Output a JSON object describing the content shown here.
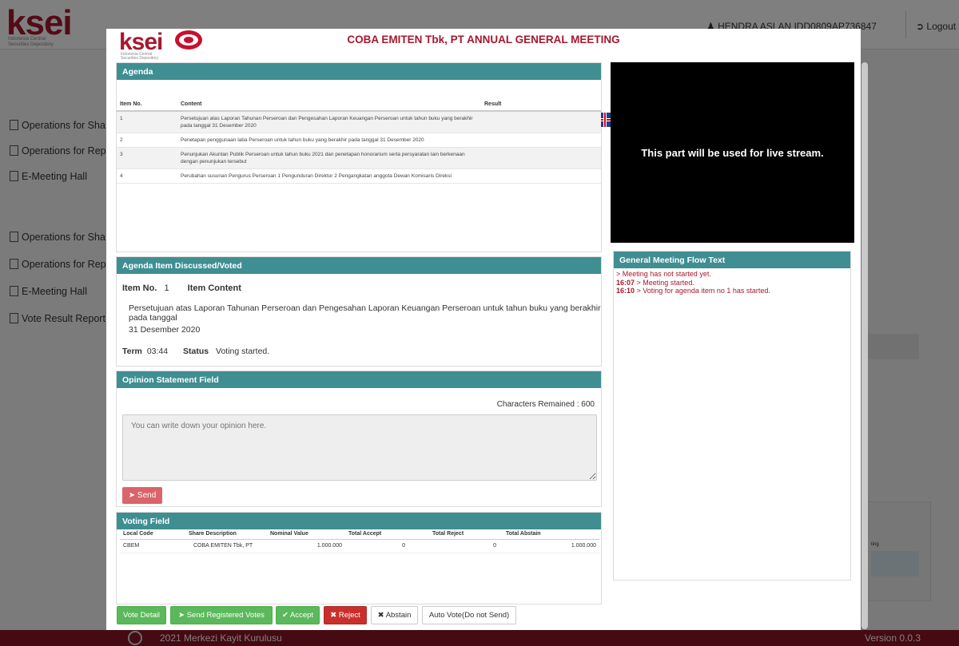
{
  "background": {
    "logo": "ksei",
    "logo_sub_1": "Indonesia Central",
    "logo_sub_2": "Securities Depository",
    "user": "HENDRA ASLAN IDD0809AP736847",
    "logout": "Logout",
    "nav_items": [
      "Operations for Sha",
      "Operations for Rep",
      "E-Meeting Hall",
      "Operations for Sha",
      "Operations for Rep",
      "E-Meeting Hall",
      "Vote Result Report"
    ],
    "footer_copy": "2021 Merkezi Kayit Kurulusu",
    "footer_version": "Version 0.0.3",
    "side_text": "ting"
  },
  "modal": {
    "logo": "ksei",
    "logo_sub_1": "Indonesia Central",
    "logo_sub_2": "Securities Depository",
    "title": "COBA EMITEN Tbk, PT ANNUAL GENERAL MEETING"
  },
  "agenda": {
    "header": "Agenda",
    "columns": [
      "Item No.",
      "Content",
      "Result"
    ],
    "rows": [
      {
        "no": "1",
        "content": "Persetujuan atas Laporan Tahunan Perseroan dan Pengesahan Laporan Keuangan Perseroan untuk tahun buku yang berakhir pada tanggal 31 Desember 2020",
        "result": ""
      },
      {
        "no": "2",
        "content": "Penetapan penggunaan laba Perseroan untuk tahun buku yang berakhir pada tanggal 31 Desember 2020",
        "result": ""
      },
      {
        "no": "3",
        "content": "Penunjukan Akuntan Publik Perseroan untuk tahun buku 2021 dan penetapan honorarium serta persyaratan lain berkenaan dengan penunjukan tersebut",
        "result": ""
      },
      {
        "no": "4",
        "content": "Perubahan susunan Pengurus Perseroan 1 Pengunduran Direktur 2 Pengangkatan anggota Dewan Komisaris Direksi",
        "result": ""
      }
    ]
  },
  "stream": {
    "text": "This part will be used for live stream."
  },
  "discussed": {
    "header": "Agenda Item Discussed/Voted",
    "item_no_label": "Item No.",
    "item_no_value": "1",
    "item_content_label": "Item Content",
    "content_line1": "Persetujuan atas Laporan Tahunan Perseroan dan Pengesahan Laporan Keuangan Perseroan untuk tahun buku yang berakhir pada tanggal",
    "content_line2": "31 Desember 2020",
    "term_label": "Term",
    "term_value": "03:44",
    "status_label": "Status",
    "status_value": "Voting started."
  },
  "opinion": {
    "header": "Opinion Statement Field",
    "chars_remaining": "Characters Remained : 600",
    "placeholder": "You can write down your opinion here.",
    "send_label": "Send"
  },
  "voting": {
    "header": "Voting Field",
    "columns": [
      "Local Code",
      "Share Description",
      "Nominal Value",
      "Total Accept",
      "Total Reject",
      "Total Abstain",
      ""
    ],
    "rows": [
      {
        "code": "CBEM",
        "desc": "COBA EMITEN Tbk, PT",
        "nominal": "1.000.000",
        "accept": "0",
        "reject": "0",
        "abstain": "1.000.000"
      }
    ]
  },
  "buttons": {
    "vote_detail": "Vote Detail",
    "send_registered": "Send Registered Votes",
    "accept": "Accept",
    "reject": "Reject",
    "abstain": "Abstain",
    "auto_vote": "Auto Vote(Do not Send)"
  },
  "flow": {
    "header": "General Meeting Flow Text",
    "lines": [
      {
        "time": "",
        "text": "> Meeting has not started yet."
      },
      {
        "time": "16:07",
        "text": " > Meeting started."
      },
      {
        "time": "16:10",
        "text": " > Voting for agenda item no 1 has started."
      }
    ]
  },
  "colors": {
    "brand_red": "#a6192e",
    "panel_teal": "#3f8e92",
    "button_green": "#5cb85c",
    "button_red": "#c9302c"
  }
}
